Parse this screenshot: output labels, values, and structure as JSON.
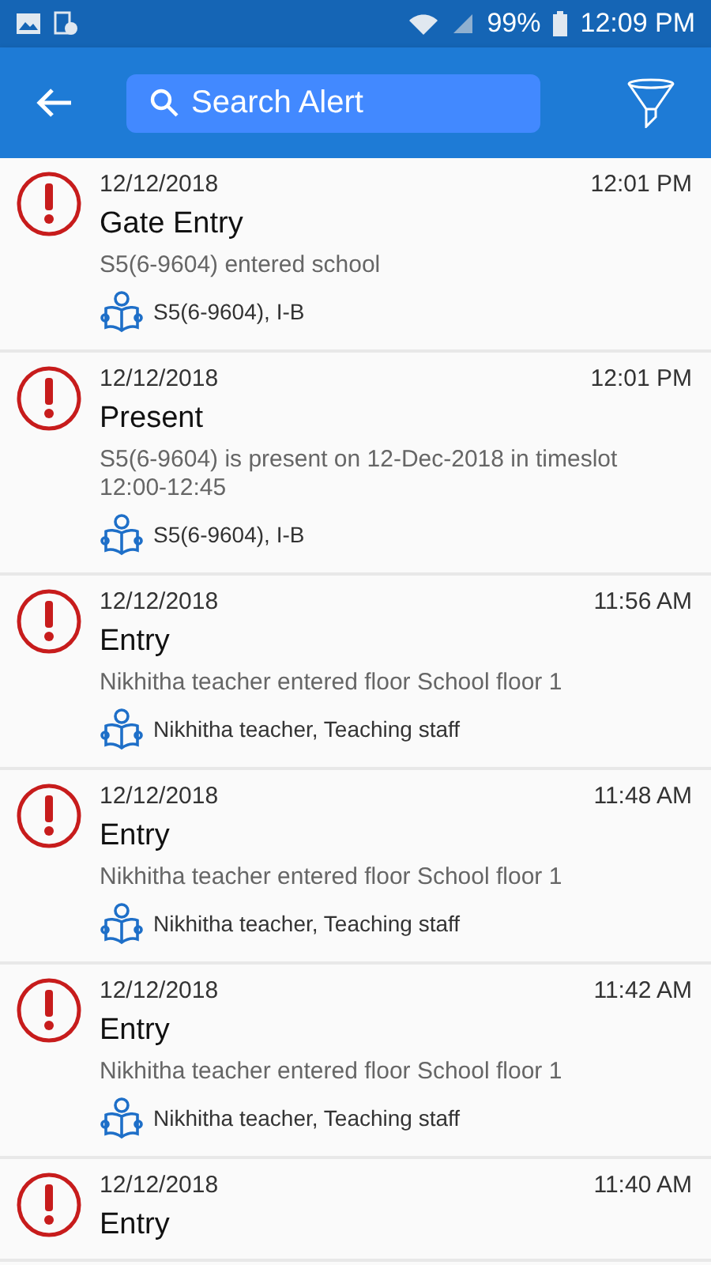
{
  "status_bar": {
    "battery": "99%",
    "time": "12:09 PM"
  },
  "header": {
    "search": {
      "placeholder": "Search Alert"
    }
  },
  "alerts": [
    {
      "date": "12/12/2018",
      "time": "12:01 PM",
      "title": "Gate Entry",
      "description": "S5(6-9604) entered school",
      "person": "S5(6-9604), I-B"
    },
    {
      "date": "12/12/2018",
      "time": "12:01 PM",
      "title": "Present",
      "description": "S5(6-9604) is present on 12-Dec-2018 in timeslot 12:00-12:45",
      "person": "S5(6-9604), I-B"
    },
    {
      "date": "12/12/2018",
      "time": "11:56 AM",
      "title": "Entry",
      "description": "Nikhitha teacher entered floor School floor 1",
      "person": "Nikhitha teacher, Teaching staff"
    },
    {
      "date": "12/12/2018",
      "time": "11:48 AM",
      "title": "Entry",
      "description": "Nikhitha teacher entered floor School floor 1",
      "person": "Nikhitha teacher, Teaching staff"
    },
    {
      "date": "12/12/2018",
      "time": "11:42 AM",
      "title": "Entry",
      "description": "Nikhitha teacher entered floor School floor 1",
      "person": "Nikhitha teacher, Teaching staff"
    },
    {
      "date": "12/12/2018",
      "time": "11:40 AM",
      "title": "Entry"
    }
  ]
}
